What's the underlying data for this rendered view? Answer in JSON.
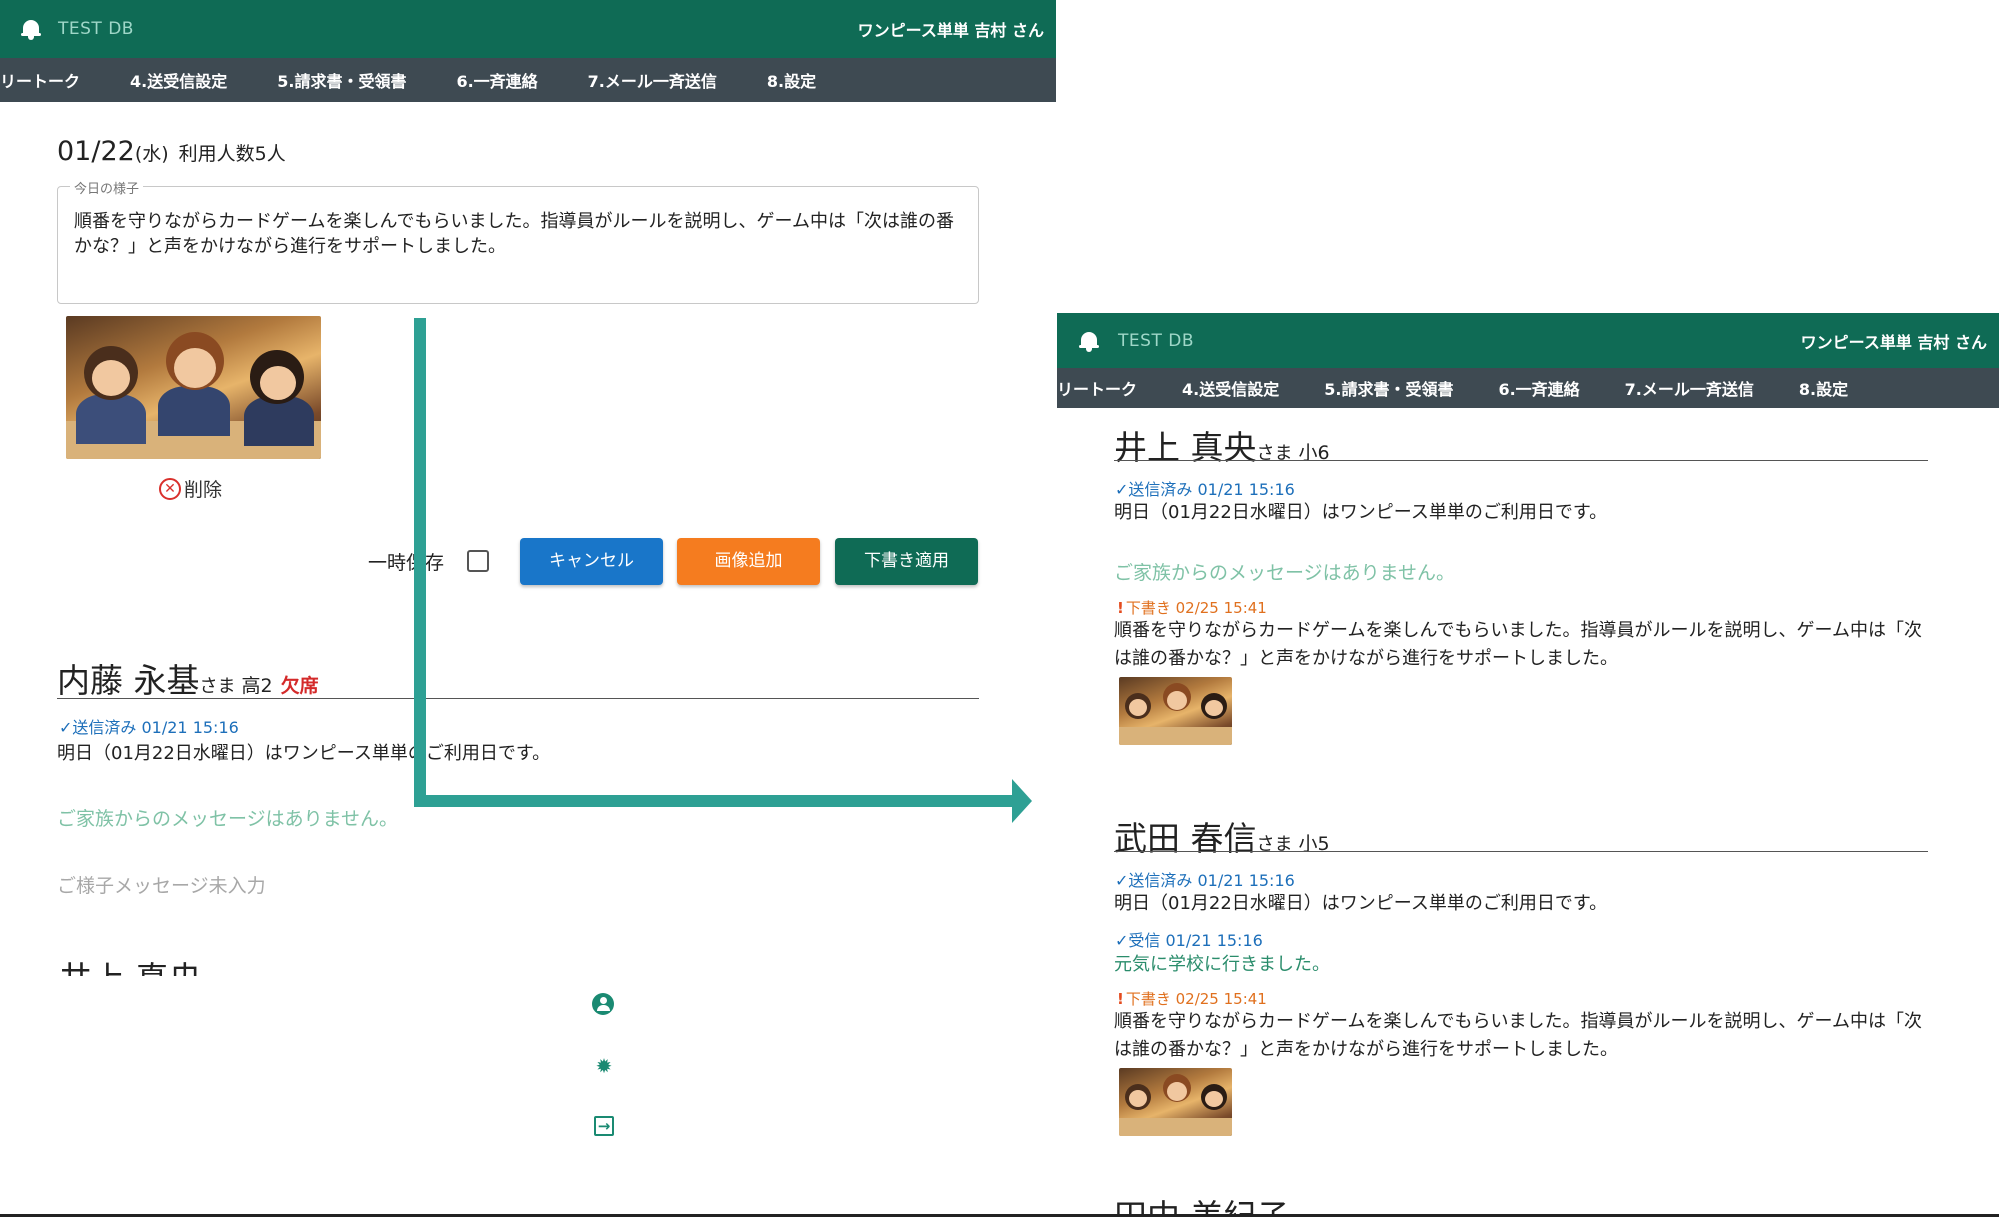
{
  "left": {
    "header": {
      "brand": "TEST DB",
      "user": "ワンピース単単 吉村 さん"
    },
    "nav": [
      "リートーク",
      "4.送受信設定",
      "5.請求書・受領書",
      "6.一斉連絡",
      "7.メール一斉送信",
      "8.設定"
    ],
    "date": {
      "day": "01/22",
      "weekday": "(水)",
      "count": "利用人数5人"
    },
    "today_form": {
      "legend": "今日の様子",
      "text": "順番を守りながらカードゲームを楽しんでもらいました。指導員がルールを説明し、ゲーム中は「次は誰の番かな？」と声をかけながら進行をサポートしました。"
    },
    "delete_label": "削除",
    "temp_save_label": "一時保存",
    "buttons": {
      "cancel": "キャンセル",
      "add_image": "画像追加",
      "apply_draft": "下書き適用"
    },
    "person": {
      "name": "内藤 永基",
      "honorific": "さま",
      "grade": "高2",
      "absent": "欠席",
      "sent": "✓送信済み 01/21 15:16",
      "message": "明日（01月22日水曜日）はワンピース単単のご利用日です。",
      "family_none": "ご家族からのメッセージはありません。",
      "state_none": "ご様子メッセージ未入力"
    },
    "next_person_cut": "井上 真央"
  },
  "right": {
    "header": {
      "brand": "TEST DB",
      "user": "ワンピース単単 吉村 さん"
    },
    "nav": [
      "リートーク",
      "4.送受信設定",
      "5.請求書・受領書",
      "6.一斉連絡",
      "7.メール一斉送信",
      "8.設定"
    ],
    "persons": [
      {
        "name": "井上 真央",
        "honorific": "さま",
        "grade": "小6",
        "sent": "✓送信済み 01/21 15:16",
        "message": "明日（01月22日水曜日）はワンピース単単のご利用日です。",
        "family_none": "ご家族からのメッセージはありません。",
        "draft": "下書き 02/25 15:41",
        "draft_text": "順番を守りながらカードゲームを楽しんでもらいました。指導員がルールを説明し、ゲーム中は「次は誰の番かな？」と声をかけながら進行をサポートしました。"
      },
      {
        "name": "武田 春信",
        "honorific": "さま",
        "grade": "小5",
        "sent": "✓送信済み 01/21 15:16",
        "message": "明日（01月22日水曜日）はワンピース単単のご利用日です。",
        "received": "✓受信 01/21 15:16",
        "received_text": "元気に学校に行きました。",
        "draft": "下書き 02/25 15:41",
        "draft_text": "順番を守りながらカードゲームを楽しんでもらいました。指導員がルールを説明し、ゲーム中は「次は誰の番かな？」と声をかけながら進行をサポートしました。"
      }
    ],
    "next_person_cut": "田中 美紀子"
  },
  "icons": {
    "bell": "bell-icon",
    "delete": "x-circle-icon",
    "account": "account-circle-icon",
    "bug": "bug-icon",
    "logout": "logout-icon"
  },
  "colors": {
    "header": "#0f6b55",
    "nav": "#3e4a52",
    "cancel": "#1976c9",
    "add_image": "#f57c1f",
    "apply": "#0f6b55",
    "arrow": "#2ea094",
    "absent": "#d42a2a",
    "family_none": "#7fc2a6",
    "draft": "#e0701e"
  }
}
